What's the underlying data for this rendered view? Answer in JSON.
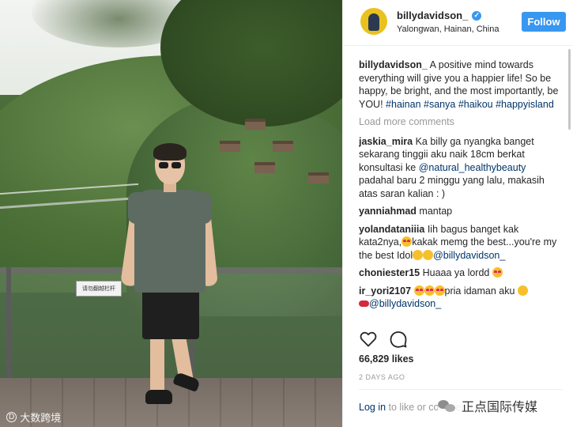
{
  "post": {
    "username": "billydavidson_",
    "location": "Yalongwan, Hainan, China",
    "follow_label": "Follow",
    "caption_user": "billydavidson_",
    "caption_text": " A positive mind towards everything will give you a happier life! So be happy, be bright, and the most importantly, be YOU! ",
    "hashtags": [
      "#hainan",
      "#sanya",
      "#haikou",
      "#happyisland"
    ],
    "load_more": "Load more comments",
    "likes": "66,829 likes",
    "time_ago": "2 DAYS AGO",
    "login_link": "Log in",
    "login_rest": " to like or comment."
  },
  "comments": [
    {
      "user": "jaskia_mira",
      "pre": " Ka billy ga nyangka banget sekarang tinggii aku naik 18cm berkat konsultasi ke ",
      "mention": "@natural_healthybeauty",
      "post": " padahal baru 2 minggu yang lalu, makasih atas saran kalian : )"
    },
    {
      "user": "yanniahmad",
      "text": " mantap"
    },
    {
      "user": "yolandataniiia",
      "pre": " Iih bagus banget kak kata2nya,",
      "mid": "kakak memg the best...you're my the best Idol",
      "mention": "@billydavidson_"
    },
    {
      "user": "choniester15",
      "text": " Huaaa ya lordd "
    },
    {
      "user": "ir_yori2107",
      "mid": "pria idaman aku ",
      "mention": "@billydavidson_"
    }
  ],
  "photo": {
    "sign_text": "请勿翻越栏杆",
    "watermark_left": "大数跨境",
    "watermark_left_logo": "D"
  },
  "watermark_right": "正点国际传媒",
  "icons": {
    "like": "heart-icon",
    "comment": "comment-icon",
    "verified": "verified-badge-icon"
  },
  "colors": {
    "accent": "#3897f0",
    "link": "#003569",
    "muted": "#999999"
  }
}
